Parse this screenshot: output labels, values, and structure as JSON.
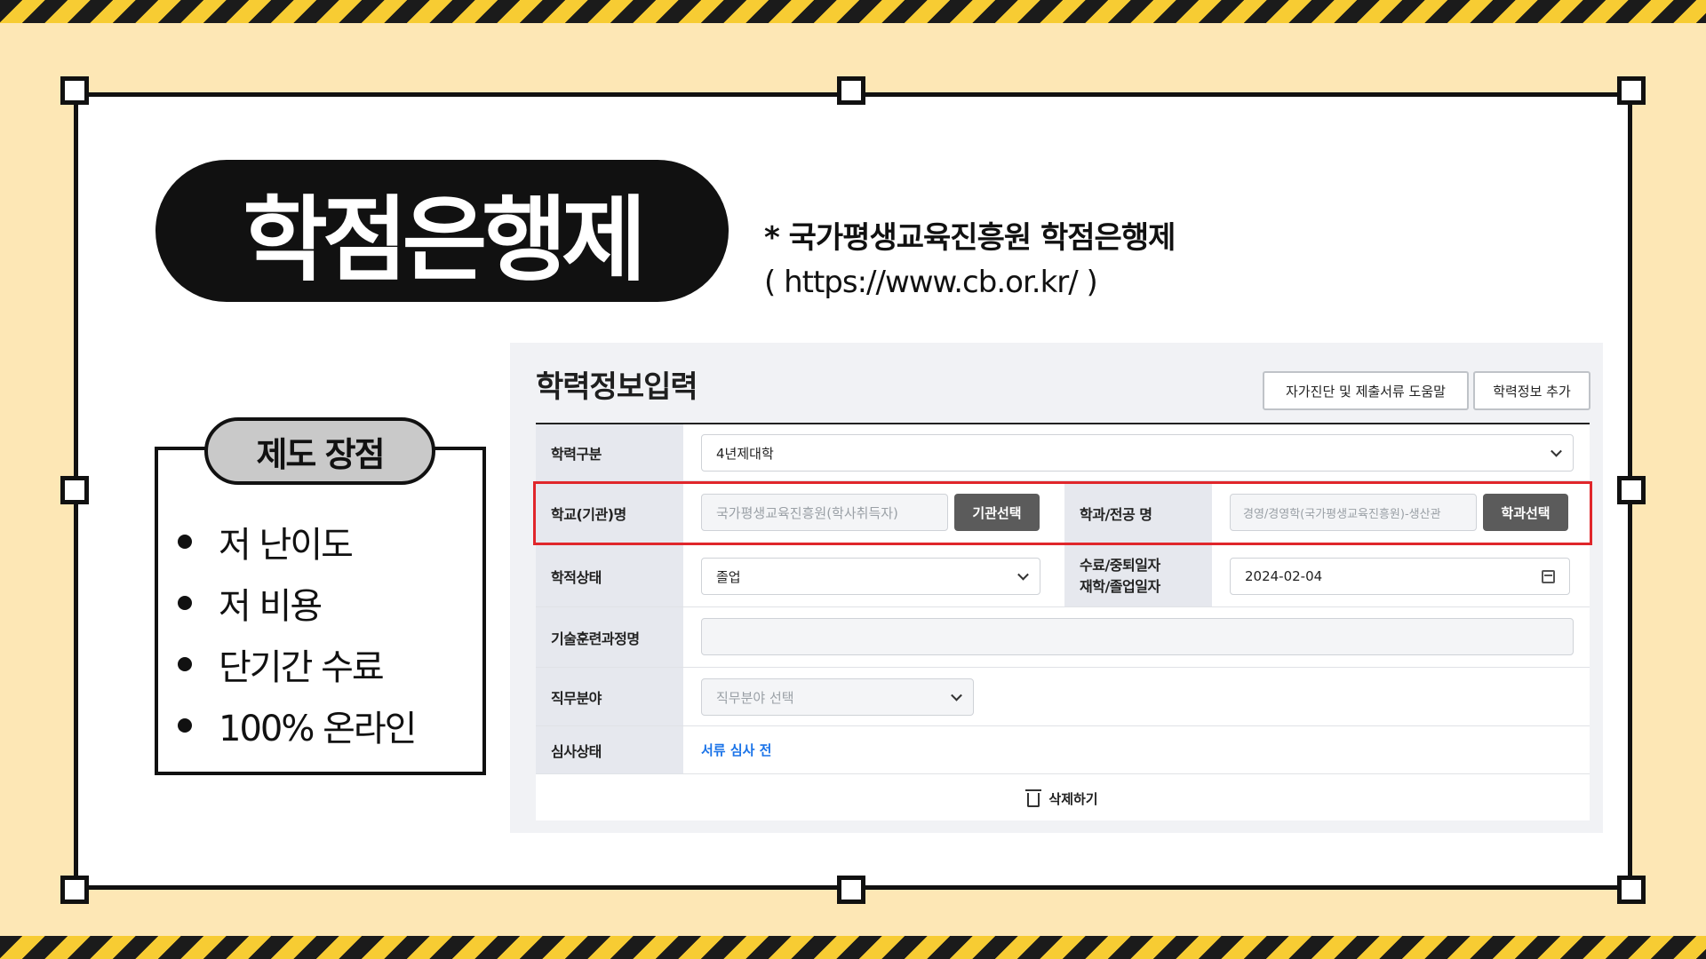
{
  "title": "학점은행제",
  "source": {
    "line1": "* 국가평생교육진흥원 학점은행제",
    "line2": "( https://www.cb.or.kr/ )"
  },
  "advantages": {
    "heading": "제도 장점",
    "items": [
      "저 난이도",
      "저 비용",
      "단기간 수료",
      "100% 온라인"
    ]
  },
  "form": {
    "title": "학력정보입력",
    "help_button": "자가진단 및 제출서류 도움말",
    "add_button": "학력정보 추가",
    "education_type": {
      "label": "학력구분",
      "value": "4년제대학"
    },
    "school": {
      "label": "학교(기관)명",
      "placeholder": "국가평생교육진흥원(학사취득자)",
      "button": "기관선택"
    },
    "major": {
      "label": "학과/전공 명",
      "placeholder": "경영/경영학(국가평생교육진흥원)-생산관",
      "button": "학과선택"
    },
    "status": {
      "label": "학적상태",
      "value": "졸업"
    },
    "date": {
      "label_line1": "수료/중퇴일자",
      "label_line2": "재학/졸업일자",
      "value": "2024-02-04"
    },
    "training": {
      "label": "기술훈련과정명",
      "value": ""
    },
    "job": {
      "label": "직무분야",
      "placeholder": "직무분야 선택"
    },
    "review": {
      "label": "심사상태",
      "value": "서류 심사 전"
    },
    "delete_button": "삭제하기"
  },
  "colors": {
    "background": "#fde7b5",
    "highlight": "#e0262b",
    "link": "#1a73e8"
  }
}
